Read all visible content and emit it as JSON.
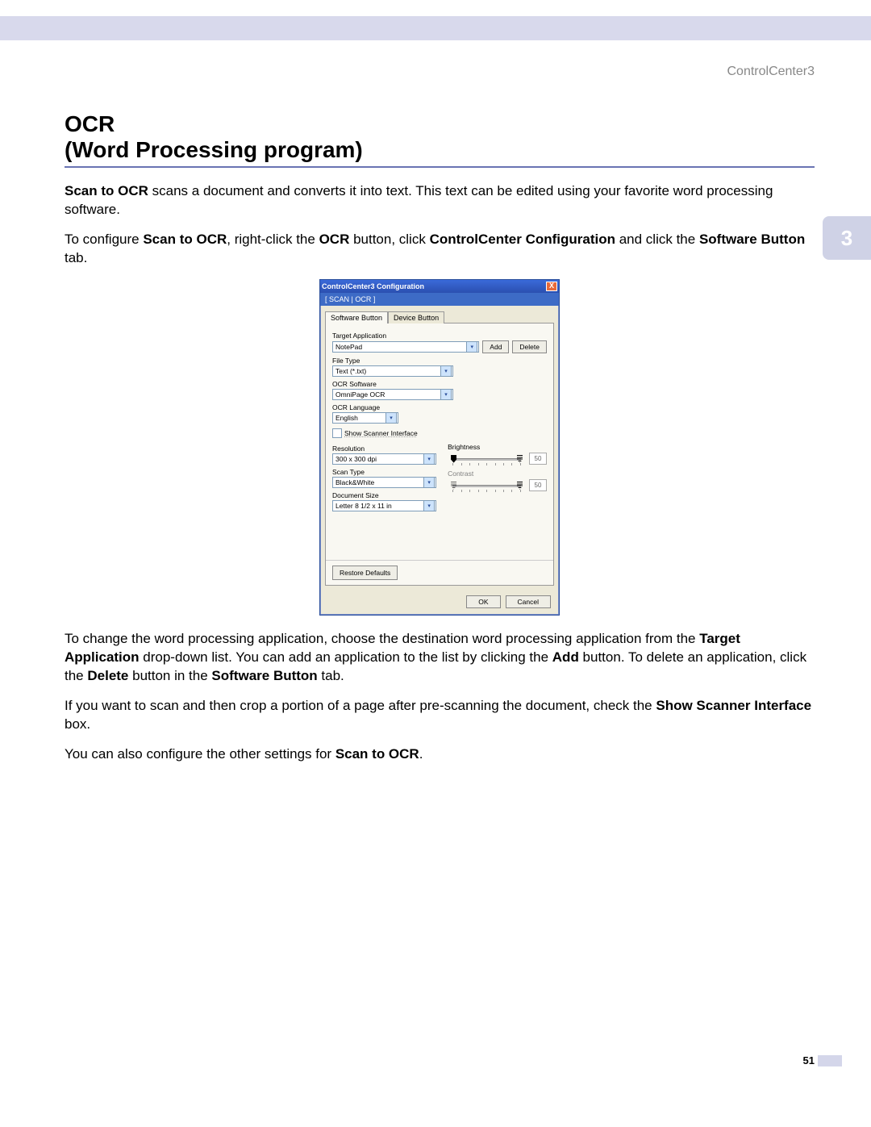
{
  "header": {
    "product": "ControlCenter3"
  },
  "chapter": {
    "number": "3"
  },
  "heading": {
    "line1": "OCR",
    "line2": "(Word Processing program)"
  },
  "para1": {
    "b1": "Scan to OCR",
    "t1": " scans a document and converts it into text. This text can be edited using your favorite word processing software."
  },
  "para2": {
    "t1": "To configure ",
    "b1": "Scan to OCR",
    "t2": ", right-click the ",
    "b2": "OCR",
    "t3": " button, click ",
    "b3": "ControlCenter Configuration",
    "t4": " and click the ",
    "b4": "Software Button",
    "t5": " tab."
  },
  "para3": {
    "t1": "To change the word processing application, choose the destination word processing application from the ",
    "b1": "Target Application",
    "t2": " drop-down list. You can add an application to the list by clicking the ",
    "b2": "Add",
    "t3": " button. To delete an application, click the ",
    "b3": "Delete",
    "t4": " button in the ",
    "b4": "Software Button",
    "t5": " tab."
  },
  "para4": {
    "t1": "If you want to scan and then crop a portion of a page after pre-scanning the document, check the ",
    "b1": "Show Scanner Interface",
    "t2": " box."
  },
  "para5": {
    "t1": "You can also configure the other settings for ",
    "b1": "Scan to OCR",
    "t2": "."
  },
  "page": {
    "number": "51"
  },
  "dialog": {
    "title": "ControlCenter3 Configuration",
    "breadcrumb": "[  SCAN  |  OCR  ]",
    "tabs": {
      "software": "Software Button",
      "device": "Device Button"
    },
    "labels": {
      "target_app": "Target Application",
      "file_type": "File Type",
      "ocr_software": "OCR Software",
      "ocr_language": "OCR Language",
      "show_scanner": "Show Scanner Interface",
      "resolution": "Resolution",
      "scan_type": "Scan Type",
      "document_size": "Document Size",
      "brightness": "Brightness",
      "contrast": "Contrast"
    },
    "values": {
      "target_app": "NotePad",
      "file_type": "Text (*.txt)",
      "ocr_software": "OmniPage OCR",
      "ocr_language": "English",
      "resolution": "300 x 300 dpi",
      "scan_type": "Black&White",
      "document_size": "Letter 8 1/2 x 11 in",
      "brightness": "50",
      "contrast": "50"
    },
    "buttons": {
      "add": "Add",
      "delete": "Delete",
      "restore": "Restore Defaults",
      "ok": "OK",
      "cancel": "Cancel",
      "close": "X"
    }
  }
}
